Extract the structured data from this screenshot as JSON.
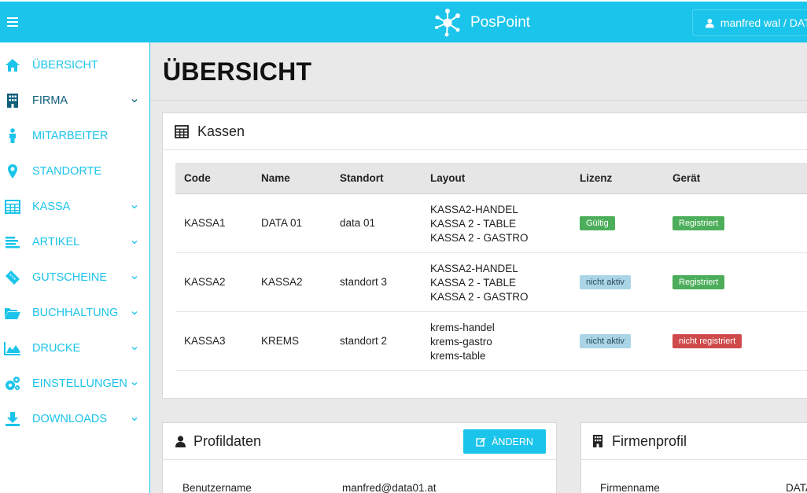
{
  "app": {
    "brand": "PosPoint"
  },
  "header": {
    "user_label": "manfred wal / DATA"
  },
  "sidebar": {
    "items": [
      {
        "label": "ÜBERSICHT",
        "icon": "home-icon",
        "has_submenu": false
      },
      {
        "label": "FIRMA",
        "icon": "building-icon",
        "has_submenu": true
      },
      {
        "label": "MITARBEITER",
        "icon": "person-icon",
        "has_submenu": false
      },
      {
        "label": "STANDORTE",
        "icon": "map-marker-icon",
        "has_submenu": false
      },
      {
        "label": "KASSA",
        "icon": "calculator-icon",
        "has_submenu": true
      },
      {
        "label": "ARTIKEL",
        "icon": "list-icon",
        "has_submenu": true
      },
      {
        "label": "GUTSCHEINE",
        "icon": "ticket-icon",
        "has_submenu": true
      },
      {
        "label": "BUCHHALTUNG",
        "icon": "folder-open-icon",
        "has_submenu": true
      },
      {
        "label": "DRUCKE",
        "icon": "area-chart-icon",
        "has_submenu": true
      },
      {
        "label": "EINSTELLUNGEN",
        "icon": "cogs-icon",
        "has_submenu": true
      },
      {
        "label": "DOWNLOADS",
        "icon": "download-icon",
        "has_submenu": true
      }
    ]
  },
  "page": {
    "title": "ÜBERSICHT"
  },
  "kassen": {
    "title": "Kassen",
    "columns": [
      "Code",
      "Name",
      "Standort",
      "Layout",
      "Lizenz",
      "Gerät"
    ],
    "rows": [
      {
        "code": "KASSA1",
        "name": "DATA 01",
        "standort": "data 01",
        "layouts": [
          "KASSA2-HANDEL",
          "KASSA 2 - TABLE",
          "KASSA 2 - GASTRO"
        ],
        "lizenz": "Gültig",
        "geraet": "Registriert"
      },
      {
        "code": "KASSA2",
        "name": "KASSA2",
        "standort": "standort 3",
        "layouts": [
          "KASSA2-HANDEL",
          "KASSA 2 - TABLE",
          "KASSA 2 - GASTRO"
        ],
        "lizenz": "nicht aktiv",
        "geraet": "Registriert"
      },
      {
        "code": "KASSA3",
        "name": "KREMS",
        "standort": "standort 2",
        "layouts": [
          "krems-handel",
          "krems-gastro",
          "krems-table"
        ],
        "lizenz": "nicht aktiv",
        "geraet": "nicht registriert"
      }
    ]
  },
  "profil": {
    "title": "Profildaten",
    "edit_label": "ÄNDERN",
    "fields": [
      {
        "label": "Benutzername",
        "value": "manfred@data01.at"
      }
    ]
  },
  "firmenprofil": {
    "title": "Firmenprofil",
    "fields": [
      {
        "label": "Firmenname",
        "value": "DATA"
      }
    ]
  },
  "colors": {
    "accent": "#1bc4ea",
    "valid": "#4cae5a",
    "inactive": "#a9d5e6",
    "unregistered": "#cf4a4a"
  }
}
